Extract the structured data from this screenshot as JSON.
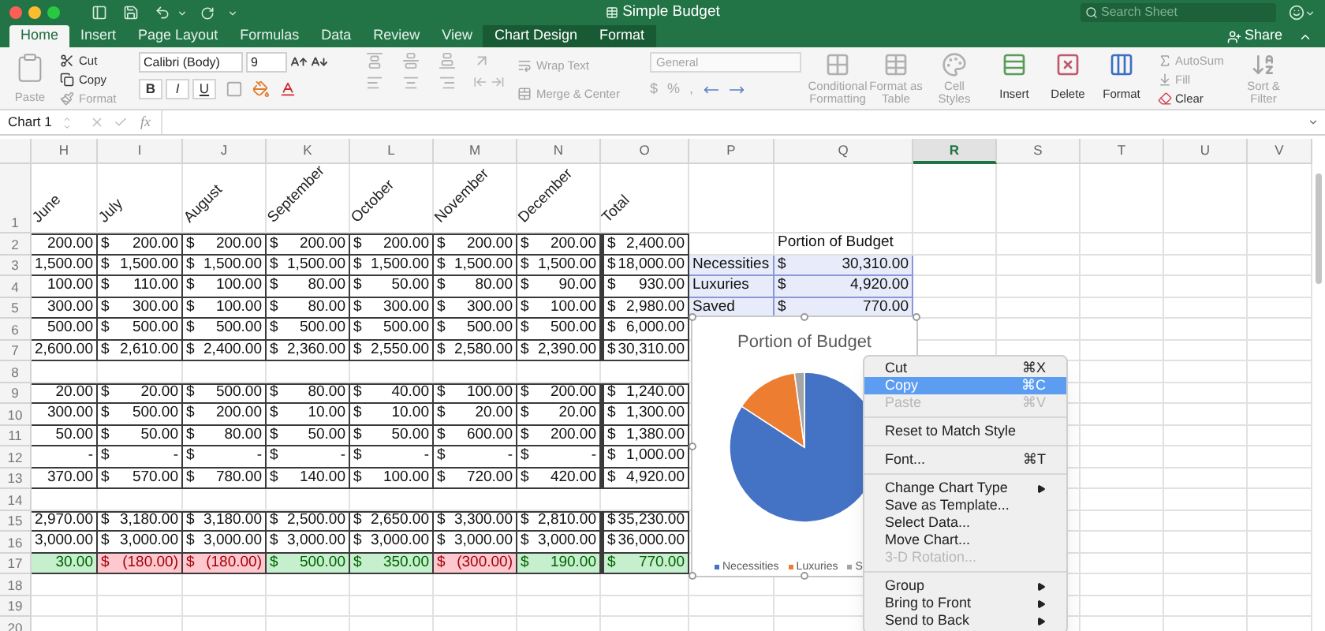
{
  "window": {
    "title": "Simple Budget",
    "search": {
      "placeholder": "Search Sheet"
    }
  },
  "tabs": [
    {
      "label": "Home",
      "selected": true,
      "contextual": false
    },
    {
      "label": "Insert",
      "selected": false,
      "contextual": false
    },
    {
      "label": "Page Layout",
      "selected": false,
      "contextual": false
    },
    {
      "label": "Formulas",
      "selected": false,
      "contextual": false
    },
    {
      "label": "Data",
      "selected": false,
      "contextual": false
    },
    {
      "label": "Review",
      "selected": false,
      "contextual": false
    },
    {
      "label": "View",
      "selected": false,
      "contextual": false
    },
    {
      "label": "Chart Design",
      "selected": false,
      "contextual": true
    },
    {
      "label": "Format",
      "selected": false,
      "contextual": true
    }
  ],
  "share": "Share",
  "ribbon": {
    "paste": {
      "label": "Paste",
      "disabled": true
    },
    "clipboard": [
      {
        "kind": "cut",
        "label": "Cut",
        "disabled": false
      },
      {
        "kind": "copy",
        "label": "Copy",
        "disabled": false
      },
      {
        "kind": "format",
        "label": "Format",
        "disabled": true
      }
    ],
    "font_family": "Calibri (Body)",
    "font_size": "9",
    "text_styles": [
      "B",
      "I",
      "U"
    ],
    "wrap_text": {
      "label": "Wrap Text",
      "disabled": true
    },
    "merge": {
      "label": "Merge & Center",
      "disabled": true
    },
    "number_format": {
      "value": "General",
      "disabled": true
    },
    "number_buttons": [
      "$",
      "%",
      ","
    ],
    "style_buttons": [
      {
        "kind": "conditional",
        "label": "Conditional Formatting",
        "disabled": true
      },
      {
        "kind": "table",
        "label": "Format as Table",
        "disabled": true
      },
      {
        "kind": "styles",
        "label": "Cell Styles",
        "disabled": true
      }
    ],
    "cell_buttons": [
      {
        "kind": "insert",
        "label": "Insert",
        "disabled": false
      },
      {
        "kind": "delete",
        "label": "Delete",
        "disabled": false
      },
      {
        "kind": "format",
        "label": "Format",
        "disabled": false
      }
    ],
    "editing": [
      {
        "kind": "sum",
        "label": "AutoSum",
        "disabled": true
      },
      {
        "kind": "fill",
        "label": "Fill",
        "disabled": true
      },
      {
        "kind": "clear",
        "label": "Clear",
        "disabled": false
      }
    ],
    "sort_filter": {
      "label": "Sort & Filter",
      "disabled": true
    }
  },
  "formula_bar": {
    "name_box": "Chart 1",
    "fx": "fx"
  },
  "sheet": {
    "columns": [
      {
        "label": "H",
        "selected": false
      },
      {
        "label": "I",
        "selected": false
      },
      {
        "label": "J",
        "selected": false
      },
      {
        "label": "K",
        "selected": false
      },
      {
        "label": "L",
        "selected": false
      },
      {
        "label": "M",
        "selected": false
      },
      {
        "label": "N",
        "selected": false
      },
      {
        "label": "O",
        "selected": false
      },
      {
        "label": "P",
        "selected": false
      },
      {
        "label": "Q",
        "selected": false
      },
      {
        "label": "R",
        "selected": true
      },
      {
        "label": "S",
        "selected": false
      },
      {
        "label": "T",
        "selected": false
      },
      {
        "label": "U",
        "selected": false
      },
      {
        "label": "V",
        "selected": false
      }
    ],
    "rows": [
      {
        "number": "1",
        "kind": "months",
        "cells": [
          {
            "a": "June"
          },
          {
            "a": "July"
          },
          {
            "a": "August"
          },
          {
            "a": "September"
          },
          {
            "a": "October"
          },
          {
            "a": "November"
          },
          {
            "a": "December"
          },
          {
            "a": "Total"
          }
        ]
      },
      {
        "number": "2",
        "kind": "data",
        "cells": [
          {
            "a": "200.00"
          },
          {
            "c": "$",
            "a": "200.00"
          },
          {
            "c": "$",
            "a": "200.00"
          },
          {
            "c": "$",
            "a": "200.00"
          },
          {
            "c": "$",
            "a": "200.00"
          },
          {
            "c": "$",
            "a": "200.00"
          },
          {
            "c": "$",
            "a": "200.00"
          },
          {
            "c": "$",
            "a": "2,400.00"
          }
        ],
        "side": {
          "title": "Portion of Budget",
          "selected": false
        }
      },
      {
        "number": "3",
        "kind": "data",
        "cells": [
          {
            "a": "1,500.00"
          },
          {
            "c": "$",
            "a": "1,500.00"
          },
          {
            "c": "$",
            "a": "1,500.00"
          },
          {
            "c": "$",
            "a": "1,500.00"
          },
          {
            "c": "$",
            "a": "1,500.00"
          },
          {
            "c": "$",
            "a": "1,500.00"
          },
          {
            "c": "$",
            "a": "1,500.00"
          },
          {
            "c": "$",
            "a": "18,000.00"
          }
        ],
        "side": {
          "label": "Necessities",
          "c": "$",
          "a": "30,310.00",
          "selected": true
        }
      },
      {
        "number": "4",
        "kind": "data",
        "cells": [
          {
            "a": "100.00"
          },
          {
            "c": "$",
            "a": "110.00"
          },
          {
            "c": "$",
            "a": "100.00"
          },
          {
            "c": "$",
            "a": "80.00"
          },
          {
            "c": "$",
            "a": "50.00"
          },
          {
            "c": "$",
            "a": "80.00"
          },
          {
            "c": "$",
            "a": "90.00"
          },
          {
            "c": "$",
            "a": "930.00"
          }
        ],
        "side": {
          "label": "Luxuries",
          "c": "$",
          "a": "4,920.00",
          "selected": true
        }
      },
      {
        "number": "5",
        "kind": "data",
        "cells": [
          {
            "a": "300.00"
          },
          {
            "c": "$",
            "a": "300.00"
          },
          {
            "c": "$",
            "a": "100.00"
          },
          {
            "c": "$",
            "a": "80.00"
          },
          {
            "c": "$",
            "a": "300.00"
          },
          {
            "c": "$",
            "a": "300.00"
          },
          {
            "c": "$",
            "a": "100.00"
          },
          {
            "c": "$",
            "a": "2,980.00"
          }
        ],
        "side": {
          "label": "Saved",
          "c": "$",
          "a": "770.00",
          "selected": true
        }
      },
      {
        "number": "6",
        "kind": "data",
        "cells": [
          {
            "a": "500.00"
          },
          {
            "c": "$",
            "a": "500.00"
          },
          {
            "c": "$",
            "a": "500.00"
          },
          {
            "c": "$",
            "a": "500.00"
          },
          {
            "c": "$",
            "a": "500.00"
          },
          {
            "c": "$",
            "a": "500.00"
          },
          {
            "c": "$",
            "a": "500.00"
          },
          {
            "c": "$",
            "a": "6,000.00"
          }
        ]
      },
      {
        "number": "7",
        "kind": "data",
        "cells": [
          {
            "a": "2,600.00"
          },
          {
            "c": "$",
            "a": "2,610.00"
          },
          {
            "c": "$",
            "a": "2,400.00"
          },
          {
            "c": "$",
            "a": "2,360.00"
          },
          {
            "c": "$",
            "a": "2,550.00"
          },
          {
            "c": "$",
            "a": "2,580.00"
          },
          {
            "c": "$",
            "a": "2,390.00"
          },
          {
            "c": "$",
            "a": "30,310.00"
          }
        ]
      },
      {
        "number": "8",
        "kind": "blank"
      },
      {
        "number": "9",
        "kind": "data",
        "cells": [
          {
            "a": "20.00"
          },
          {
            "c": "$",
            "a": "20.00"
          },
          {
            "c": "$",
            "a": "500.00"
          },
          {
            "c": "$",
            "a": "80.00"
          },
          {
            "c": "$",
            "a": "40.00"
          },
          {
            "c": "$",
            "a": "100.00"
          },
          {
            "c": "$",
            "a": "200.00"
          },
          {
            "c": "$",
            "a": "1,240.00"
          }
        ]
      },
      {
        "number": "10",
        "kind": "data",
        "cells": [
          {
            "a": "300.00"
          },
          {
            "c": "$",
            "a": "500.00"
          },
          {
            "c": "$",
            "a": "200.00"
          },
          {
            "c": "$",
            "a": "10.00"
          },
          {
            "c": "$",
            "a": "10.00"
          },
          {
            "c": "$",
            "a": "20.00"
          },
          {
            "c": "$",
            "a": "20.00"
          },
          {
            "c": "$",
            "a": "1,300.00"
          }
        ]
      },
      {
        "number": "11",
        "kind": "data",
        "cells": [
          {
            "a": "50.00"
          },
          {
            "c": "$",
            "a": "50.00"
          },
          {
            "c": "$",
            "a": "80.00"
          },
          {
            "c": "$",
            "a": "50.00"
          },
          {
            "c": "$",
            "a": "50.00"
          },
          {
            "c": "$",
            "a": "600.00"
          },
          {
            "c": "$",
            "a": "200.00"
          },
          {
            "c": "$",
            "a": "1,380.00"
          }
        ]
      },
      {
        "number": "12",
        "kind": "data",
        "cells": [
          {
            "a": "-"
          },
          {
            "c": "$",
            "a": "-"
          },
          {
            "c": "$",
            "a": "-"
          },
          {
            "c": "$",
            "a": "-"
          },
          {
            "c": "$",
            "a": "-"
          },
          {
            "c": "$",
            "a": "-"
          },
          {
            "c": "$",
            "a": "-"
          },
          {
            "c": "$",
            "a": "1,000.00"
          }
        ]
      },
      {
        "number": "13",
        "kind": "data",
        "cells": [
          {
            "a": "370.00"
          },
          {
            "c": "$",
            "a": "570.00"
          },
          {
            "c": "$",
            "a": "780.00"
          },
          {
            "c": "$",
            "a": "140.00"
          },
          {
            "c": "$",
            "a": "100.00"
          },
          {
            "c": "$",
            "a": "720.00"
          },
          {
            "c": "$",
            "a": "420.00"
          },
          {
            "c": "$",
            "a": "4,920.00"
          }
        ]
      },
      {
        "number": "14",
        "kind": "blank"
      },
      {
        "number": "15",
        "kind": "data",
        "cells": [
          {
            "a": "2,970.00"
          },
          {
            "c": "$",
            "a": "3,180.00"
          },
          {
            "c": "$",
            "a": "3,180.00"
          },
          {
            "c": "$",
            "a": "2,500.00"
          },
          {
            "c": "$",
            "a": "2,650.00"
          },
          {
            "c": "$",
            "a": "3,300.00"
          },
          {
            "c": "$",
            "a": "2,810.00"
          },
          {
            "c": "$",
            "a": "35,230.00"
          }
        ]
      },
      {
        "number": "16",
        "kind": "data",
        "cells": [
          {
            "a": "3,000.00"
          },
          {
            "c": "$",
            "a": "3,000.00"
          },
          {
            "c": "$",
            "a": "3,000.00"
          },
          {
            "c": "$",
            "a": "3,000.00"
          },
          {
            "c": "$",
            "a": "3,000.00"
          },
          {
            "c": "$",
            "a": "3,000.00"
          },
          {
            "c": "$",
            "a": "3,000.00"
          },
          {
            "c": "$",
            "a": "36,000.00"
          }
        ]
      },
      {
        "number": "17",
        "kind": "data",
        "cells": [
          {
            "a": "30.00",
            "negative": false
          },
          {
            "c": "$",
            "a": "(180.00)",
            "negative": true
          },
          {
            "c": "$",
            "a": "(180.00)",
            "negative": true
          },
          {
            "c": "$",
            "a": "500.00",
            "negative": false
          },
          {
            "c": "$",
            "a": "350.00",
            "negative": false
          },
          {
            "c": "$",
            "a": "(300.00)",
            "negative": true
          },
          {
            "c": "$",
            "a": "190.00",
            "negative": false
          },
          {
            "c": "$",
            "a": "770.00",
            "negative": false
          }
        ]
      },
      {
        "number": "18",
        "kind": "blank"
      },
      {
        "number": "19",
        "kind": "blank"
      },
      {
        "number": "20",
        "kind": "blank"
      }
    ]
  },
  "chart": {
    "chart_data": {
      "type": "pie",
      "title": "Portion of Budget",
      "categories": [
        "Necessities",
        "Luxuries",
        "S"
      ],
      "values": [
        84.19,
        13.67,
        2.14
      ],
      "legend": "bottom"
    }
  },
  "context_menu": {
    "items": [
      {
        "kind": "item",
        "label": "Cut",
        "shortcut": "⌘X",
        "submenu": false,
        "disabled": false,
        "selected": false
      },
      {
        "kind": "item",
        "label": "Copy",
        "shortcut": "⌘C",
        "submenu": false,
        "disabled": false,
        "selected": true
      },
      {
        "kind": "item",
        "label": "Paste",
        "shortcut": "⌘V",
        "submenu": false,
        "disabled": true,
        "selected": false
      },
      {
        "kind": "separator"
      },
      {
        "kind": "item",
        "label": "Reset to Match Style",
        "submenu": false,
        "disabled": false,
        "selected": false
      },
      {
        "kind": "separator"
      },
      {
        "kind": "item",
        "label": "Font...",
        "shortcut": "⌘T",
        "submenu": false,
        "disabled": false,
        "selected": false
      },
      {
        "kind": "separator"
      },
      {
        "kind": "item",
        "label": "Change Chart Type",
        "submenu": true,
        "disabled": false,
        "selected": false
      },
      {
        "kind": "item",
        "label": "Save as Template...",
        "submenu": false,
        "disabled": false,
        "selected": false
      },
      {
        "kind": "item",
        "label": "Select Data...",
        "submenu": false,
        "disabled": false,
        "selected": false
      },
      {
        "kind": "item",
        "label": "Move Chart...",
        "submenu": false,
        "disabled": false,
        "selected": false
      },
      {
        "kind": "item",
        "label": "3-D Rotation...",
        "submenu": false,
        "disabled": true,
        "selected": false
      },
      {
        "kind": "separator"
      },
      {
        "kind": "item",
        "label": "Group",
        "submenu": true,
        "disabled": false,
        "selected": false
      },
      {
        "kind": "item",
        "label": "Bring to Front",
        "submenu": true,
        "disabled": false,
        "selected": false
      },
      {
        "kind": "item",
        "label": "Send to Back",
        "submenu": true,
        "disabled": false,
        "selected": false
      }
    ]
  }
}
